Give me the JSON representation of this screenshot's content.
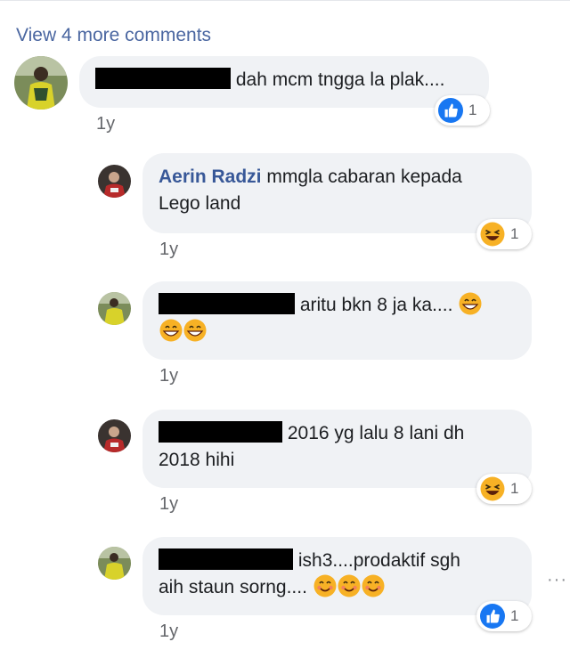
{
  "view_more": "View 4 more comments",
  "comments": [
    {
      "text": "dah mcm tngga la plak....",
      "time": "1y",
      "reaction": {
        "icon": "like-icon",
        "count": "1"
      }
    },
    {
      "author": "Aerin Radzi",
      "text_line1": "mmgla cabaran kepada",
      "text_line2": "Lego land",
      "time": "1y",
      "reaction": {
        "icon": "laughing-emoji-icon",
        "count": "1"
      }
    },
    {
      "text": "aritu bkn 8 ja ka....",
      "time": "1y",
      "emojis": [
        "grinning-emoji-icon",
        "grinning-emoji-icon",
        "grinning-emoji-icon"
      ]
    },
    {
      "text_line1": "2016 yg lalu 8 lani dh",
      "text_line2": "2018 hihi",
      "time": "1y",
      "reaction": {
        "icon": "laughing-emoji-icon",
        "count": "1"
      }
    },
    {
      "text_line1": "ish3....prodaktif sgh",
      "text_line2": "aih staun sorng....",
      "time": "1y",
      "emojis": [
        "smiling-emoji-icon",
        "smiling-emoji-icon",
        "smiling-emoji-icon"
      ],
      "reaction": {
        "icon": "like-icon",
        "count": "1"
      }
    }
  ],
  "more_options": "···"
}
